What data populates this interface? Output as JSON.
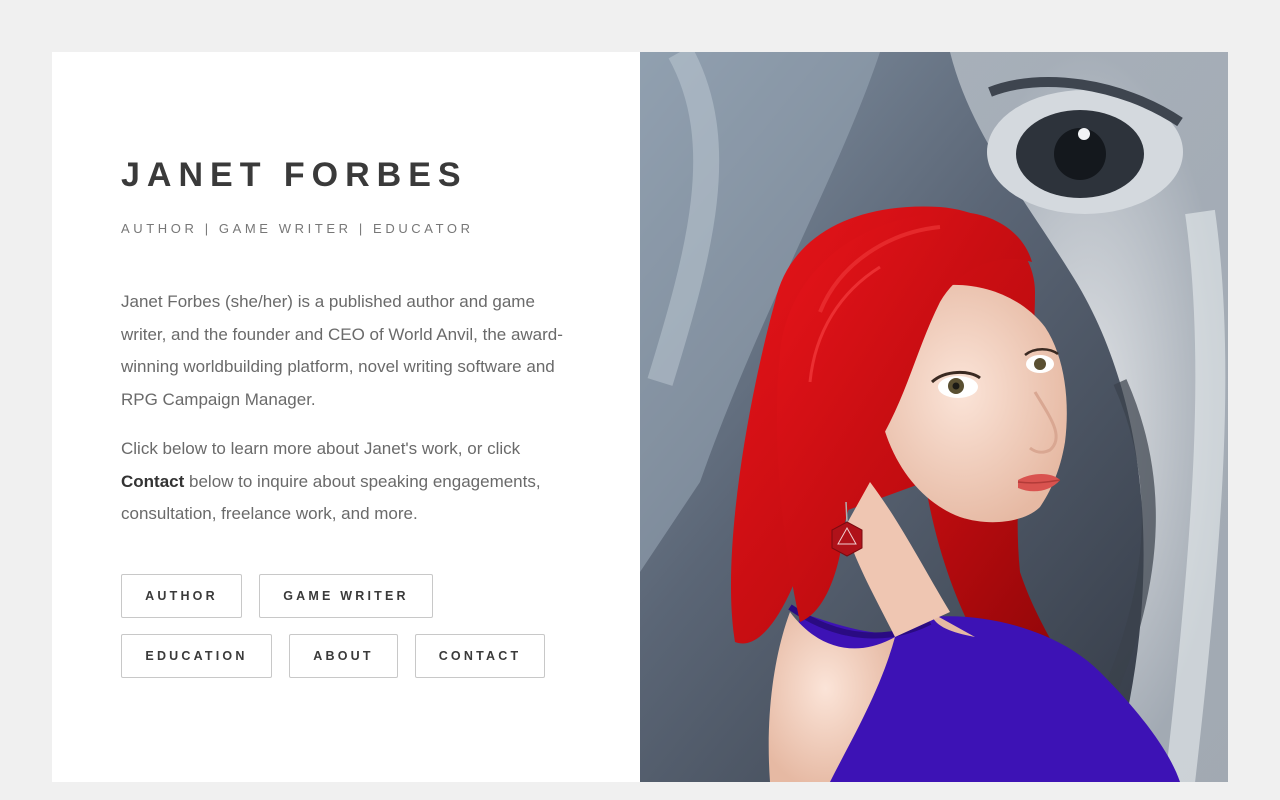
{
  "header": {
    "name": "JANET FORBES",
    "tagline": "AUTHOR | GAME WRITER | EDUCATOR"
  },
  "bio": {
    "paragraph1": "Janet Forbes (she/her) is a published author and game writer, and the founder and CEO of World Anvil, the award-winning worldbuilding platform, novel writing software and RPG Campaign Manager.",
    "paragraph2_before": "Click below to learn more about Janet's work, or click ",
    "paragraph2_bold": "Contact",
    "paragraph2_after": " below to inquire about speaking engagements, consultation, freelance work, and more."
  },
  "buttons": {
    "author": "AUTHOR",
    "game_writer": "GAME WRITER",
    "education": "EDUCATION",
    "about": "ABOUT",
    "contact": "CONTACT"
  },
  "colors": {
    "page_background": "#f0f0f0",
    "card_background": "#ffffff",
    "heading": "#3a3a3a",
    "body_text": "#6a6a6a",
    "button_border": "#c8c8c8",
    "hair": "#d40f14",
    "dress": "#3d12b5"
  }
}
